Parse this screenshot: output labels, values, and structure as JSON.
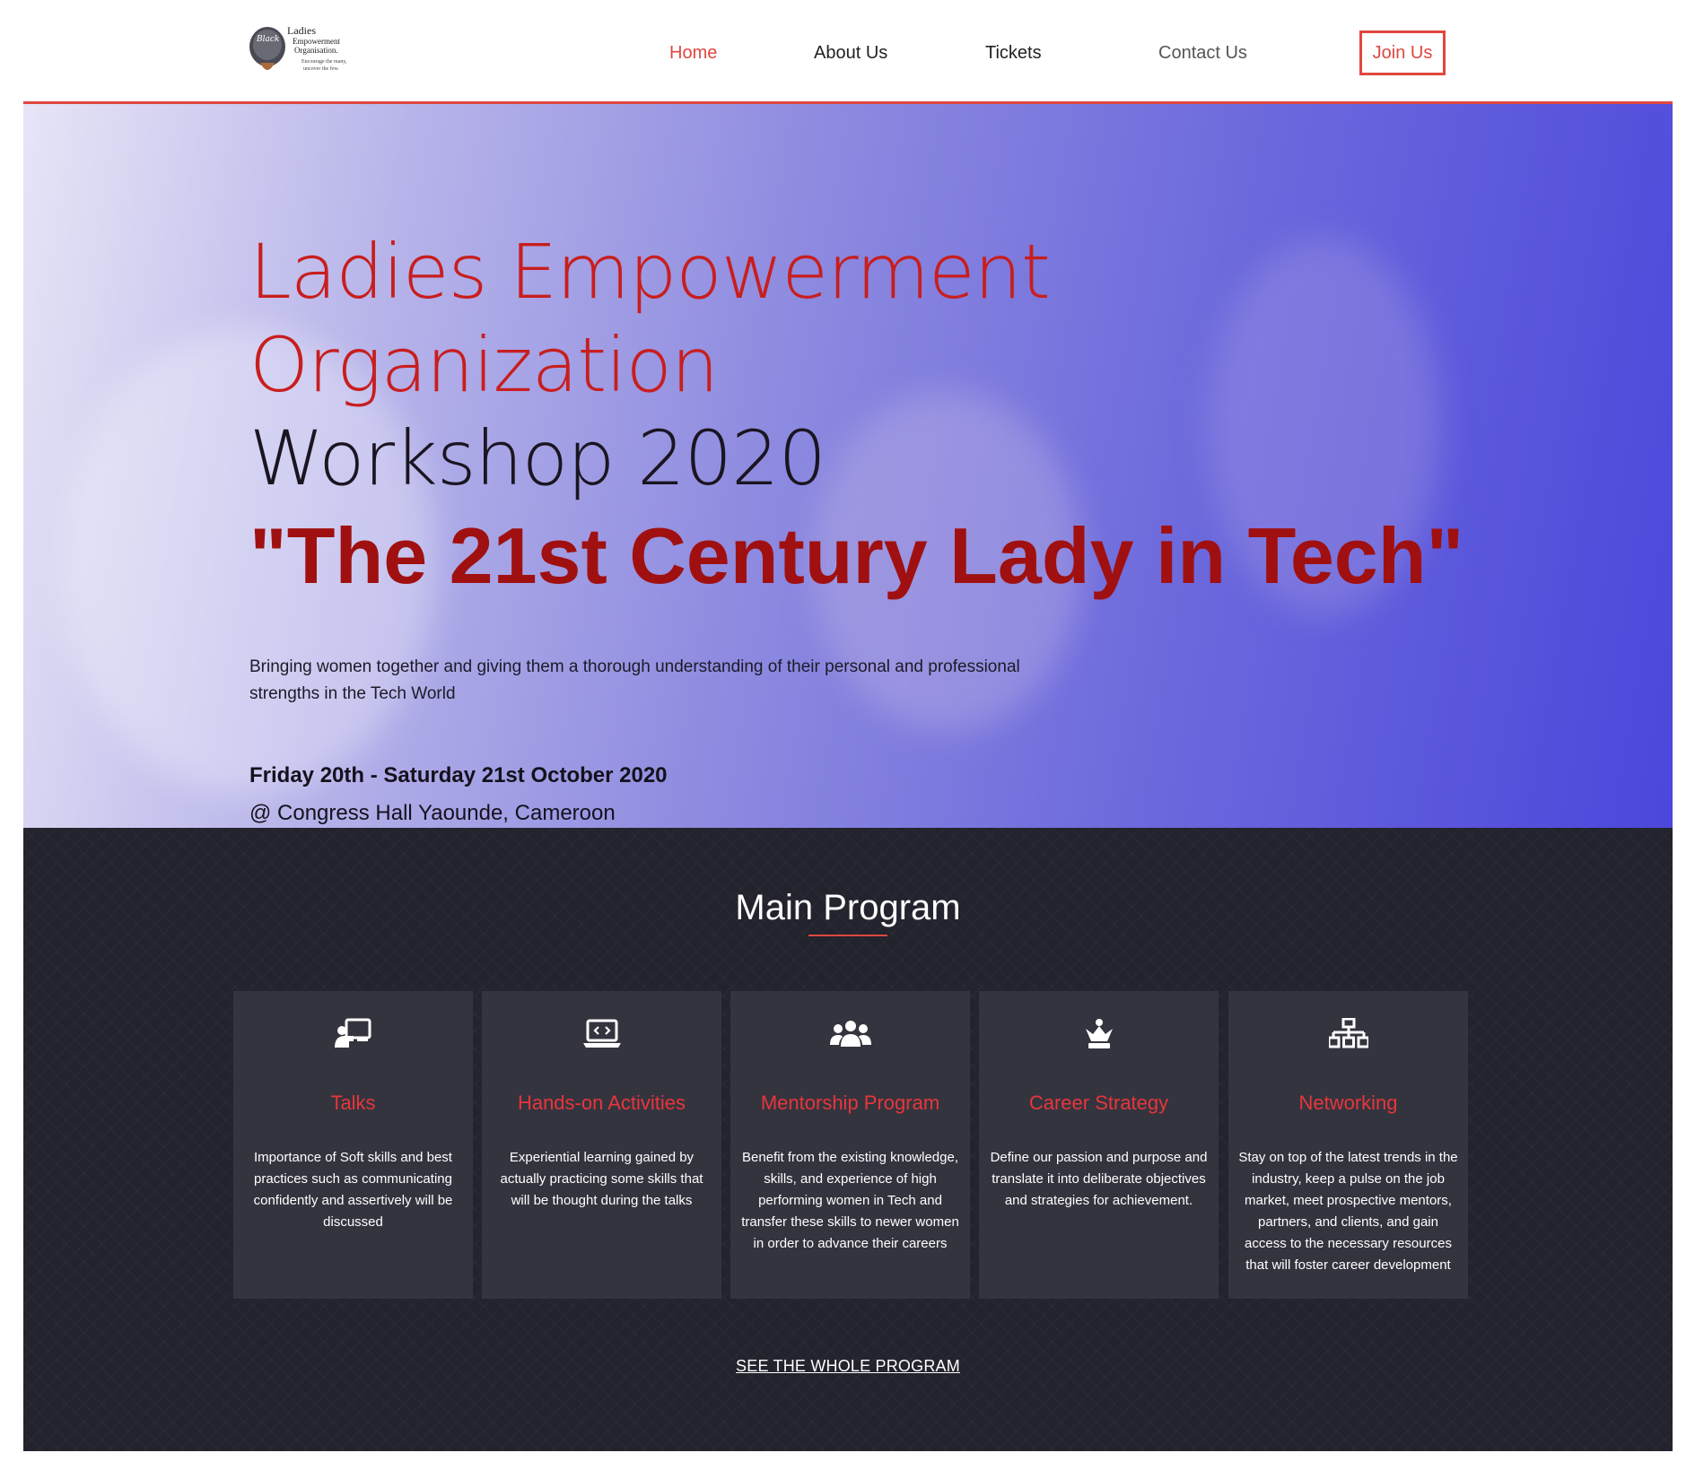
{
  "logo": {
    "line1": "Ladies",
    "line2": "Empowerment",
    "line3": "Organisation.",
    "tagline1": "Encourage the many,",
    "tagline2": "uncover the few.",
    "badge": "Black"
  },
  "nav": {
    "home": "Home",
    "about": "About Us",
    "tickets": "Tickets",
    "contact": "Contact Us",
    "join": "Join Us"
  },
  "hero": {
    "title_line1": "Ladies Empowerment Organization",
    "title_line2": "Workshop 2020",
    "title_line3": "\"The 21st Century Lady in Tech\"",
    "description": "Bringing women together and giving them a thorough understanding of their personal and professional strengths in the Tech World",
    "date": "Friday 20th - Saturday 21st October 2020",
    "venue": "@ Congress Hall Yaounde, Cameroon"
  },
  "program": {
    "title": "Main Program",
    "cards": [
      {
        "icon": "presentation-icon",
        "title": "Talks",
        "description": "Importance of Soft skills and best practices such as communicating confidently and assertively will be discussed"
      },
      {
        "icon": "laptop-code-icon",
        "title": "Hands-on Activities",
        "description": "Experiential learning gained by actually practicing some skills that will be thought during the talks"
      },
      {
        "icon": "users-icon",
        "title": "Mentorship Program",
        "description": "Benefit from the existing knowledge, skills, and experience of high performing women in Tech and transfer these skills to newer women in order to advance their careers"
      },
      {
        "icon": "chess-queen-icon",
        "title": "Career Strategy",
        "description": "Define our passion and purpose and translate it into deliberate objectives and strategies for achievement."
      },
      {
        "icon": "network-icon",
        "title": "Networking",
        "description": "Stay on top of the latest trends in the industry, keep a pulse on the job market, meet prospective mentors, partners, and clients, and gain access to the necessary resources that will foster career development"
      }
    ],
    "link": "SEE THE WHOLE PROGRAM"
  },
  "colors": {
    "accent": "#e0473f",
    "hero_title": "#c81e1e",
    "card_bg": "#34343f",
    "section_bg": "#23232d"
  }
}
